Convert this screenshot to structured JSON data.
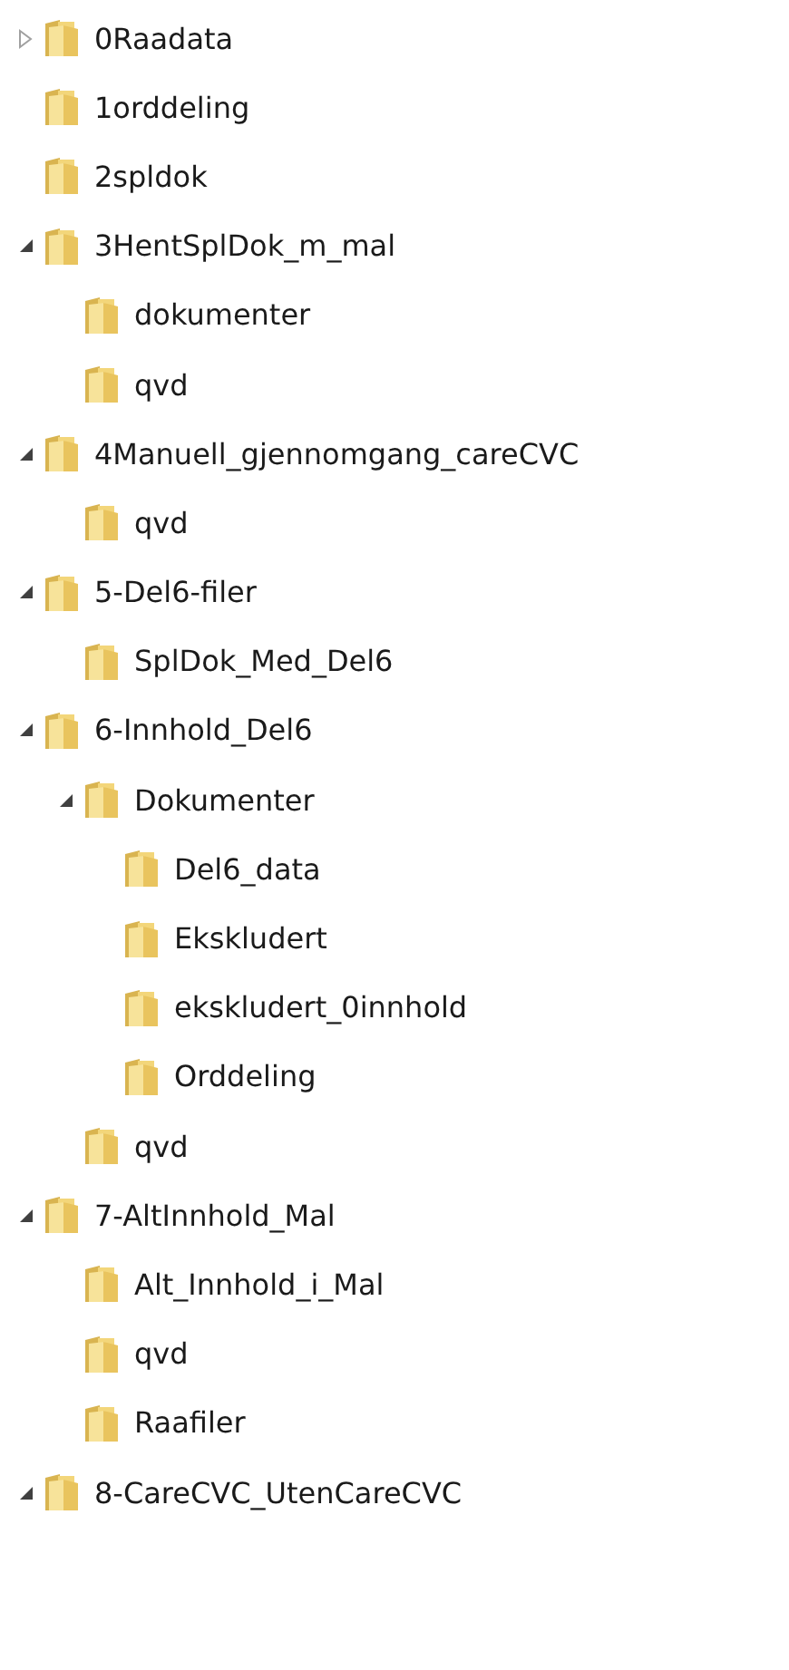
{
  "tree": [
    {
      "label": "0Raadata",
      "expanded": false
    },
    {
      "label": "1orddeling"
    },
    {
      "label": "2spldok"
    },
    {
      "label": "3HentSplDok_m_mal",
      "expanded": true,
      "children": [
        {
          "label": "dokumenter"
        },
        {
          "label": "qvd"
        }
      ]
    },
    {
      "label": "4Manuell_gjennomgang_careCVC",
      "expanded": true,
      "children": [
        {
          "label": "qvd"
        }
      ]
    },
    {
      "label": "5-Del6-filer",
      "expanded": true,
      "children": [
        {
          "label": "SplDok_Med_Del6"
        }
      ]
    },
    {
      "label": "6-Innhold_Del6",
      "expanded": true,
      "children": [
        {
          "label": "Dokumenter",
          "expanded": true,
          "children": [
            {
              "label": "Del6_data"
            },
            {
              "label": "Ekskludert"
            },
            {
              "label": "ekskludert_0innhold"
            },
            {
              "label": "Orddeling"
            }
          ]
        },
        {
          "label": "qvd"
        }
      ]
    },
    {
      "label": "7-AltInnhold_Mal",
      "expanded": true,
      "children": [
        {
          "label": "Alt_Innhold_i_Mal"
        },
        {
          "label": "qvd"
        },
        {
          "label": "Raafiler"
        }
      ]
    },
    {
      "label": "8-CareCVC_UtenCareCVC",
      "expanded": true
    }
  ]
}
